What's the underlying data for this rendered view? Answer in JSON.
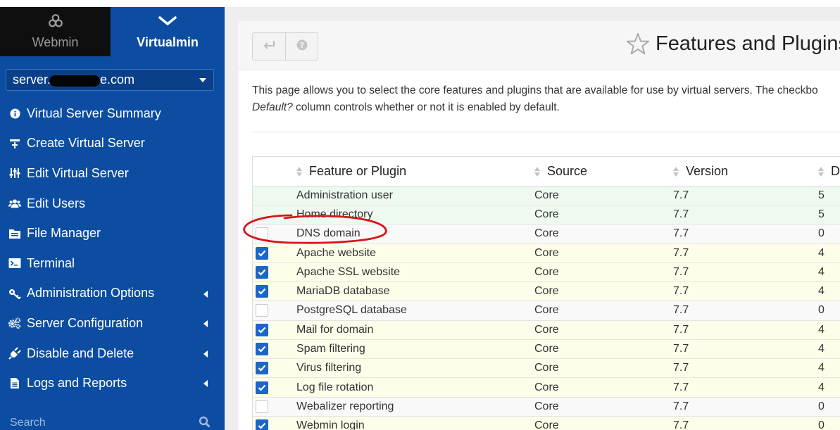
{
  "switcher": {
    "webmin_label": "Webmin",
    "virtualmin_label": "Virtualmin"
  },
  "domain_select": {
    "value_prefix": "server.",
    "value_suffix": "e.com"
  },
  "menu": [
    {
      "label": "Virtual Server Summary",
      "icon": "info-circle-icon",
      "submenu": false
    },
    {
      "label": "Create Virtual Server",
      "icon": "create-server-icon",
      "submenu": false
    },
    {
      "label": "Edit Virtual Server",
      "icon": "sliders-icon",
      "submenu": false
    },
    {
      "label": "Edit Users",
      "icon": "users-icon",
      "submenu": false
    },
    {
      "label": "File Manager",
      "icon": "file-manager-icon",
      "submenu": false
    },
    {
      "label": "Terminal",
      "icon": "terminal-icon",
      "submenu": false
    },
    {
      "label": "Administration Options",
      "icon": "key-icon",
      "submenu": true
    },
    {
      "label": "Server Configuration",
      "icon": "cogs-icon",
      "submenu": true
    },
    {
      "label": "Disable and Delete",
      "icon": "plug-icon",
      "submenu": true
    },
    {
      "label": "Logs and Reports",
      "icon": "document-icon",
      "submenu": true
    }
  ],
  "search": {
    "placeholder": "Search"
  },
  "toolbar": {
    "title": "Features and Plugins"
  },
  "intro": {
    "line1": "This page allows you to select the core features and plugins that are available for use by virtual servers. The checkbo",
    "line2_em": "Default?",
    "line2_rest": " column controls whether or not it is enabled by default."
  },
  "table": {
    "columns": [
      "Feature or Plugin",
      "Source",
      "Version",
      "D"
    ],
    "rows": [
      {
        "checkbox": "none",
        "name": "Administration user",
        "source": "Core",
        "version": "7.7",
        "d": "5",
        "style": "enabled-fixed"
      },
      {
        "checkbox": "none",
        "name": "Home directory",
        "source": "Core",
        "version": "7.7",
        "d": "5",
        "style": "enabled-fixed"
      },
      {
        "checkbox": "off",
        "name": "DNS domain",
        "source": "Core",
        "version": "7.7",
        "d": "0",
        "style": "unchecked-row"
      },
      {
        "checkbox": "on",
        "name": "Apache website",
        "source": "Core",
        "version": "7.7",
        "d": "4",
        "style": "checked-row"
      },
      {
        "checkbox": "on",
        "name": "Apache SSL website",
        "source": "Core",
        "version": "7.7",
        "d": "4",
        "style": "checked-row"
      },
      {
        "checkbox": "on",
        "name": "MariaDB database",
        "source": "Core",
        "version": "7.7",
        "d": "4",
        "style": "checked-row"
      },
      {
        "checkbox": "off",
        "name": "PostgreSQL database",
        "source": "Core",
        "version": "7.7",
        "d": "0",
        "style": "unchecked-row"
      },
      {
        "checkbox": "on",
        "name": "Mail for domain",
        "source": "Core",
        "version": "7.7",
        "d": "4",
        "style": "checked-row"
      },
      {
        "checkbox": "on",
        "name": "Spam filtering",
        "source": "Core",
        "version": "7.7",
        "d": "4",
        "style": "checked-row"
      },
      {
        "checkbox": "on",
        "name": "Virus filtering",
        "source": "Core",
        "version": "7.7",
        "d": "4",
        "style": "checked-row"
      },
      {
        "checkbox": "on",
        "name": "Log file rotation",
        "source": "Core",
        "version": "7.7",
        "d": "4",
        "style": "checked-row"
      },
      {
        "checkbox": "off",
        "name": "Webalizer reporting",
        "source": "Core",
        "version": "7.7",
        "d": "0",
        "style": "unchecked-row"
      },
      {
        "checkbox": "on",
        "name": "Webmin login",
        "source": "Core",
        "version": "7.7",
        "d": "0",
        "style": "checked-row"
      }
    ]
  },
  "colors": {
    "sidebar_bg": "#0c4da2",
    "webmin_tab_bg": "#0f0f0f",
    "checkbox_on": "#1a66c9",
    "annotation": "#d8141b"
  }
}
